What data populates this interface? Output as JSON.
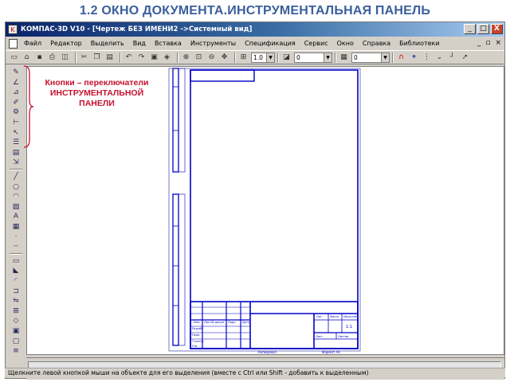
{
  "slide": {
    "title": "1.2 ОКНО ДОКУМЕНТА.ИНСТРУМЕНТАЛЬНАЯ ПАНЕЛЬ",
    "annotation_line1": "Кнопки – переключатели",
    "annotation_line2": "ИНСТРУМЕНТАЛЬНОЙ",
    "annotation_line3": "ПАНЕЛИ",
    "annotation_color": "#c8102e",
    "title_color": "#3a5f9c"
  },
  "window": {
    "title": "КОМПАС-3D V10 - [Чертеж БЕЗ ИМЕНИ2 ->Системный вид]",
    "controls": {
      "minimize": "_",
      "maximize": "□",
      "close": "X"
    }
  },
  "menubar": {
    "items": [
      "Файл",
      "Редактор",
      "Выделить",
      "Вид",
      "Вставка",
      "Инструменты",
      "Спецификация",
      "Сервис",
      "Окно",
      "Справка",
      "Библиотеки"
    ],
    "mdi_controls": {
      "minimize": "_",
      "restore": "▫",
      "close": "×"
    }
  },
  "toolbar": {
    "scale_value": "1.0",
    "layer_value": "0",
    "style_value": "0"
  },
  "left_panel": {
    "buttons": [
      "geometry-icon",
      "dimensions-icon",
      "designations-icon",
      "edit-icon",
      "parametrization-icon",
      "measure-icon",
      "select-icon",
      "spec-icon",
      "reports-icon",
      "insert-icon",
      "line-icon",
      "circle-icon",
      "arc-icon",
      "hatch-icon",
      "text-icon",
      "table-icon",
      "point-icon",
      "aux-line-icon",
      "rectangle-icon",
      "chamfer-icon",
      "fillet-icon",
      "offset-icon",
      "symmetry-icon",
      "collection-icon",
      "contour-icon",
      "view-icon",
      "group-icon",
      "layer-icon"
    ]
  },
  "drawing": {
    "title_block_labels": [
      "Лит.",
      "Масса",
      "Масштаб",
      "1:1",
      "Лист",
      "Листов",
      "Копировал",
      "Формат А4",
      "Изм.",
      "Лист",
      "№ докум.",
      "Подп.",
      "Дата",
      "Разраб.",
      "Пров.",
      "Т.контр.",
      "Н.контр.",
      "Утв."
    ]
  },
  "statusbar": {
    "text": "Щелкните левой кнопкой мыши на объекте для его выделения (вместе с Ctrl или Shift - добавить к выделенным)"
  }
}
